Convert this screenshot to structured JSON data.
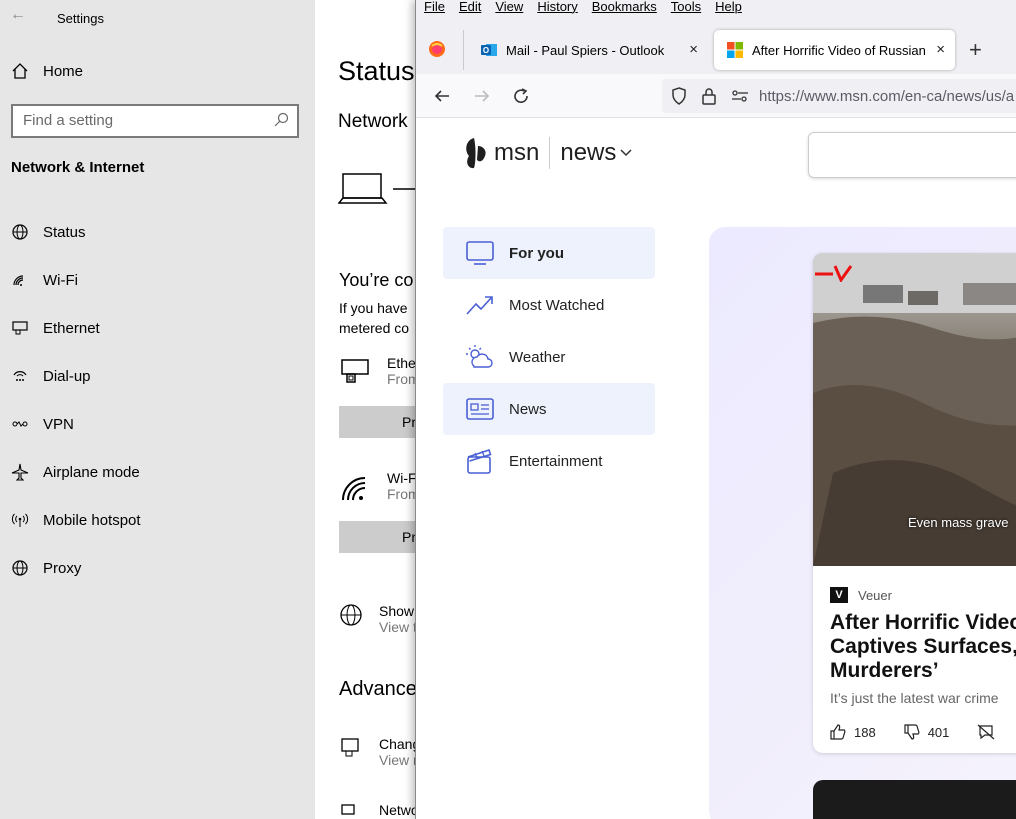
{
  "settings": {
    "window_title": "Settings",
    "home_label": "Home",
    "search_placeholder": "Find a setting",
    "section_title": "Network & Internet",
    "nav": [
      {
        "label": "Status",
        "icon": "globe-icon"
      },
      {
        "label": "Wi-Fi",
        "icon": "wifi-icon"
      },
      {
        "label": "Ethernet",
        "icon": "ethernet-icon"
      },
      {
        "label": "Dial-up",
        "icon": "dialup-icon"
      },
      {
        "label": "VPN",
        "icon": "vpn-icon"
      },
      {
        "label": "Airplane mode",
        "icon": "airplane-icon"
      },
      {
        "label": "Mobile hotspot",
        "icon": "hotspot-icon"
      },
      {
        "label": "Proxy",
        "icon": "globe-icon"
      }
    ],
    "main": {
      "heading": "Status",
      "subheading": "Network",
      "connected_text": "You’re co",
      "para_line1": "If you have",
      "para_line2": "metered co",
      "ethernet_title": "Ethe",
      "ethernet_sub": "From",
      "prop_btn1": "Pr",
      "wifi_title": "Wi-F",
      "wifi_sub": "From",
      "prop_btn2": "Pr",
      "show_title": "Show",
      "show_sub": "View t",
      "advanced": "Advance",
      "change_title": "Chang",
      "change_sub": "View n",
      "network_title": "Netwo"
    }
  },
  "firefox": {
    "menu": [
      "File",
      "Edit",
      "View",
      "History",
      "Bookmarks",
      "Tools",
      "Help"
    ],
    "tabs": [
      {
        "title": "Mail - Paul Spiers - Outlook",
        "close": "×"
      },
      {
        "title": "After Horrific Video of Russian",
        "close": "×"
      }
    ],
    "new_tab": "+",
    "url": "https://www.msn.com/en-ca/news/us/a"
  },
  "msn": {
    "logo_text": "msn",
    "section": "news",
    "feed_nav": [
      {
        "label": "For you",
        "icon": "monitor-icon"
      },
      {
        "label": "Most Watched",
        "icon": "trending-icon"
      },
      {
        "label": "Weather",
        "icon": "weather-icon"
      },
      {
        "label": "News",
        "icon": "newspaper-icon"
      },
      {
        "label": "Entertainment",
        "icon": "clapper-icon"
      }
    ],
    "card": {
      "image_caption": "Even mass grave",
      "source": "Veuer",
      "source_logo": "V",
      "title": "After Horrific Video Captives Surfaces, Murderers’",
      "title_lines": [
        "After Horrific Video",
        "Captives Surfaces, Z",
        "Murderers’"
      ],
      "description": "It’s just the latest war crime",
      "likes": "188",
      "dislikes": "401"
    }
  }
}
